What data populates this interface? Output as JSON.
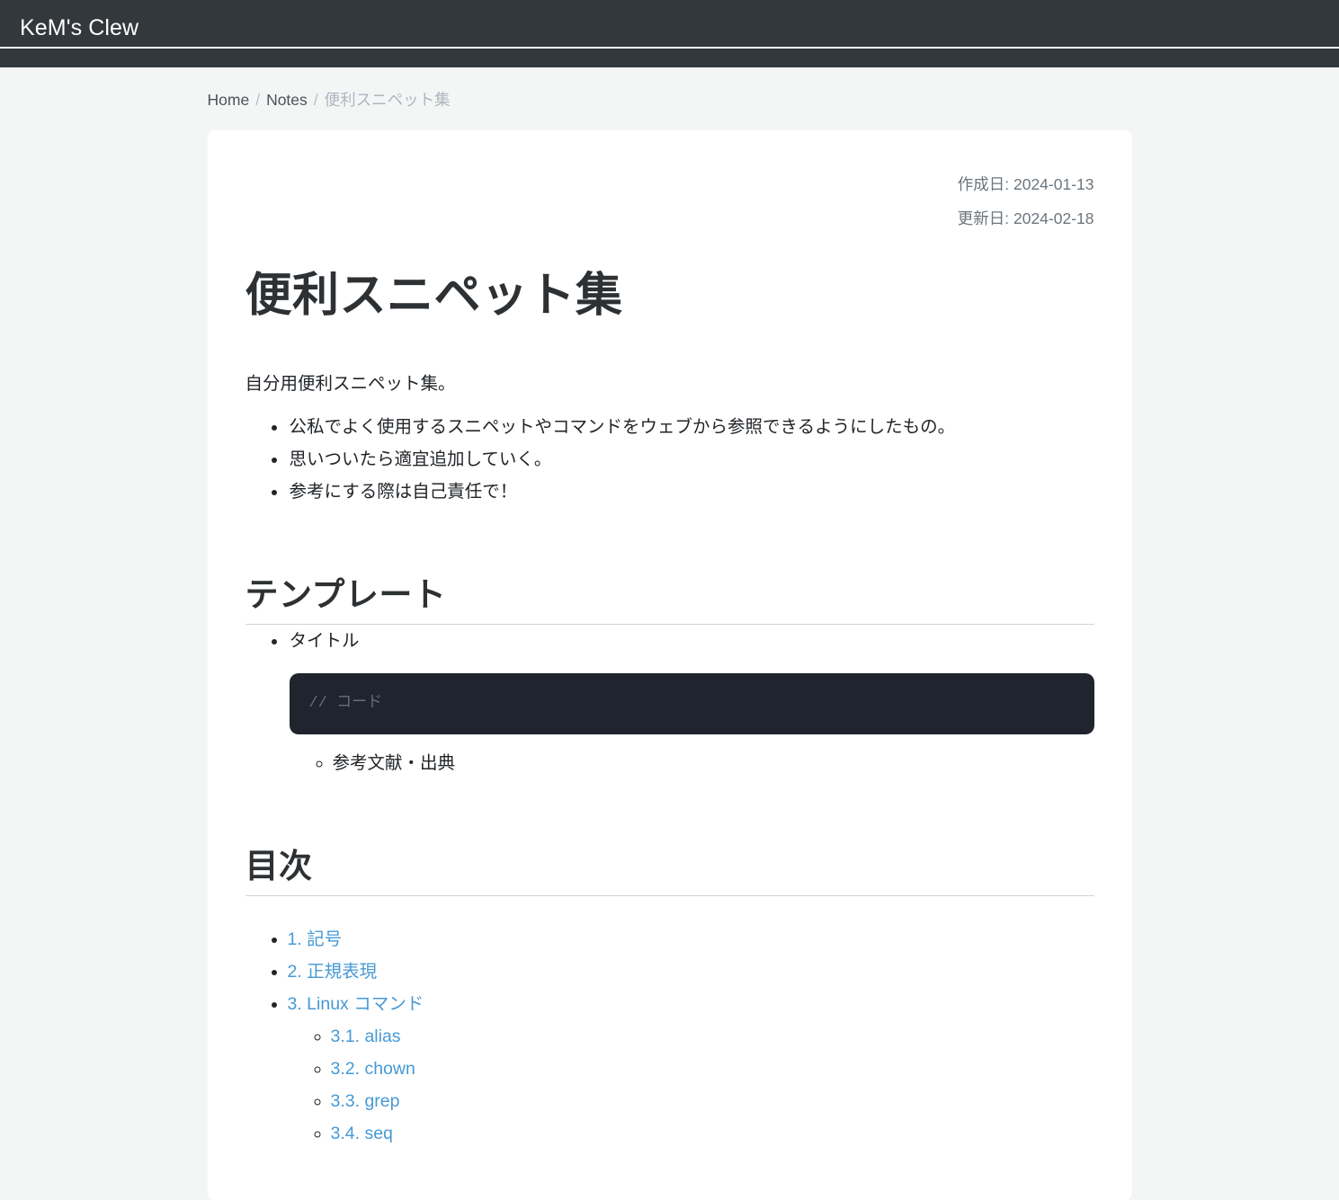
{
  "site": {
    "brand": "KeM's Clew"
  },
  "breadcrumb": {
    "items": [
      {
        "label": "Home",
        "link": true
      },
      {
        "label": "Notes",
        "link": true
      },
      {
        "label": "便利スニペット集",
        "link": false
      }
    ],
    "separator": "/"
  },
  "post": {
    "created_label": "作成日: 2024-01-13",
    "updated_label": "更新日: 2024-02-18",
    "title": "便利スニペット集",
    "intro": "自分用便利スニペット集。",
    "intro_bullets": [
      "公私でよく使用するスニペットやコマンドをウェブから参照できるようにしたもの。",
      "思いついたら適宜追加していく。",
      "参考にする際は自己責任で！"
    ]
  },
  "template_section": {
    "heading": "テンプレート",
    "item_title": "タイトル",
    "code": "// コード",
    "sub_item": "参考文献・出典"
  },
  "toc_section": {
    "heading": "目次",
    "items": [
      {
        "label": "1. 記号"
      },
      {
        "label": "2. 正規表現"
      },
      {
        "label": "3. Linux コマンド",
        "children": [
          {
            "label": "3.1. alias"
          },
          {
            "label": "3.2. chown"
          },
          {
            "label": "3.3. grep"
          },
          {
            "label": "3.4. seq"
          }
        ]
      }
    ]
  },
  "colors": {
    "navbar_bg": "#33383d",
    "page_bg": "#f4f6f6",
    "card_bg": "#ffffff",
    "link": "#4799d4",
    "code_bg": "#1f242e",
    "code_text": "#656e82",
    "muted": "#6c757d"
  }
}
